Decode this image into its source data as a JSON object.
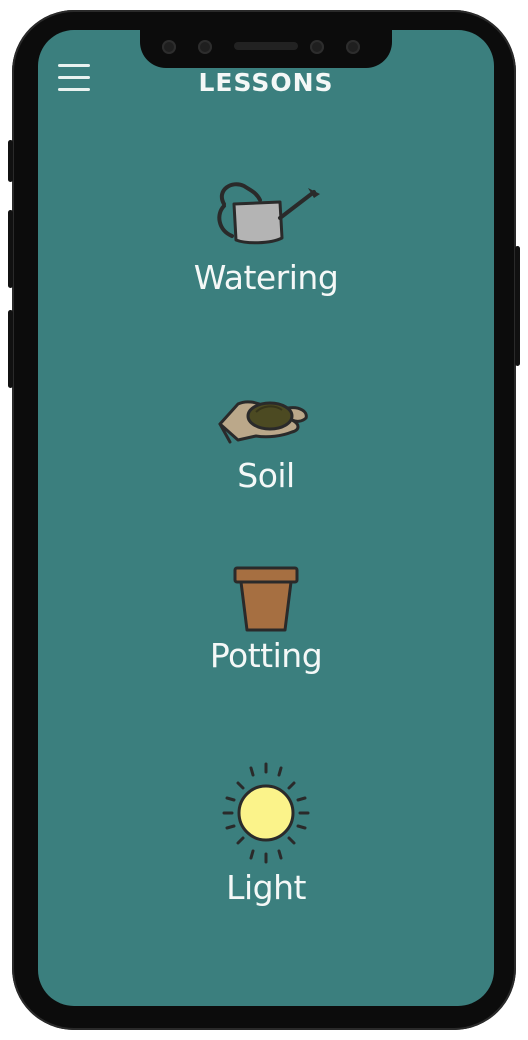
{
  "header": {
    "title": "LESSONS",
    "menu_icon": "hamburger-menu-icon"
  },
  "lessons": [
    {
      "label": "Watering",
      "icon": "watering-can-icon"
    },
    {
      "label": "Soil",
      "icon": "hand-holding-soil-icon"
    },
    {
      "label": "Potting",
      "icon": "flower-pot-icon"
    },
    {
      "label": "Light",
      "icon": "sun-icon"
    }
  ],
  "colors": {
    "background": "#3b7f7e",
    "text": "#f4f8f7",
    "frame": "#0c0c0c"
  }
}
